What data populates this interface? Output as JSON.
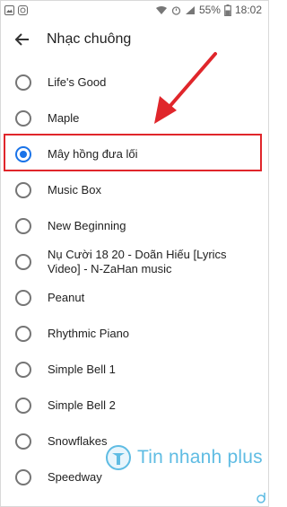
{
  "status_bar": {
    "battery": "55%",
    "time": "18:02"
  },
  "header": {
    "title": "Nhạc chuông"
  },
  "ringtones": [
    {
      "label": "Life's Good",
      "selected": false
    },
    {
      "label": "Maple",
      "selected": false
    },
    {
      "label": "Mây hồng đưa lối",
      "selected": true
    },
    {
      "label": "Music Box",
      "selected": false
    },
    {
      "label": "New Beginning",
      "selected": false
    },
    {
      "label": "Nụ Cười 18 20 - Doãn Hiếu [Lyrics Video] - N-ZaHan music",
      "selected": false
    },
    {
      "label": "Peanut",
      "selected": false
    },
    {
      "label": "Rhythmic Piano",
      "selected": false
    },
    {
      "label": "Simple Bell 1",
      "selected": false
    },
    {
      "label": "Simple Bell 2",
      "selected": false
    },
    {
      "label": "Snowflakes",
      "selected": false
    },
    {
      "label": "Speedway",
      "selected": false
    }
  ],
  "watermark": {
    "text": "Tin nhanh plus"
  },
  "colors": {
    "accent": "#1a73e8",
    "highlight": "#e0262b",
    "watermark": "#5fbce3"
  }
}
